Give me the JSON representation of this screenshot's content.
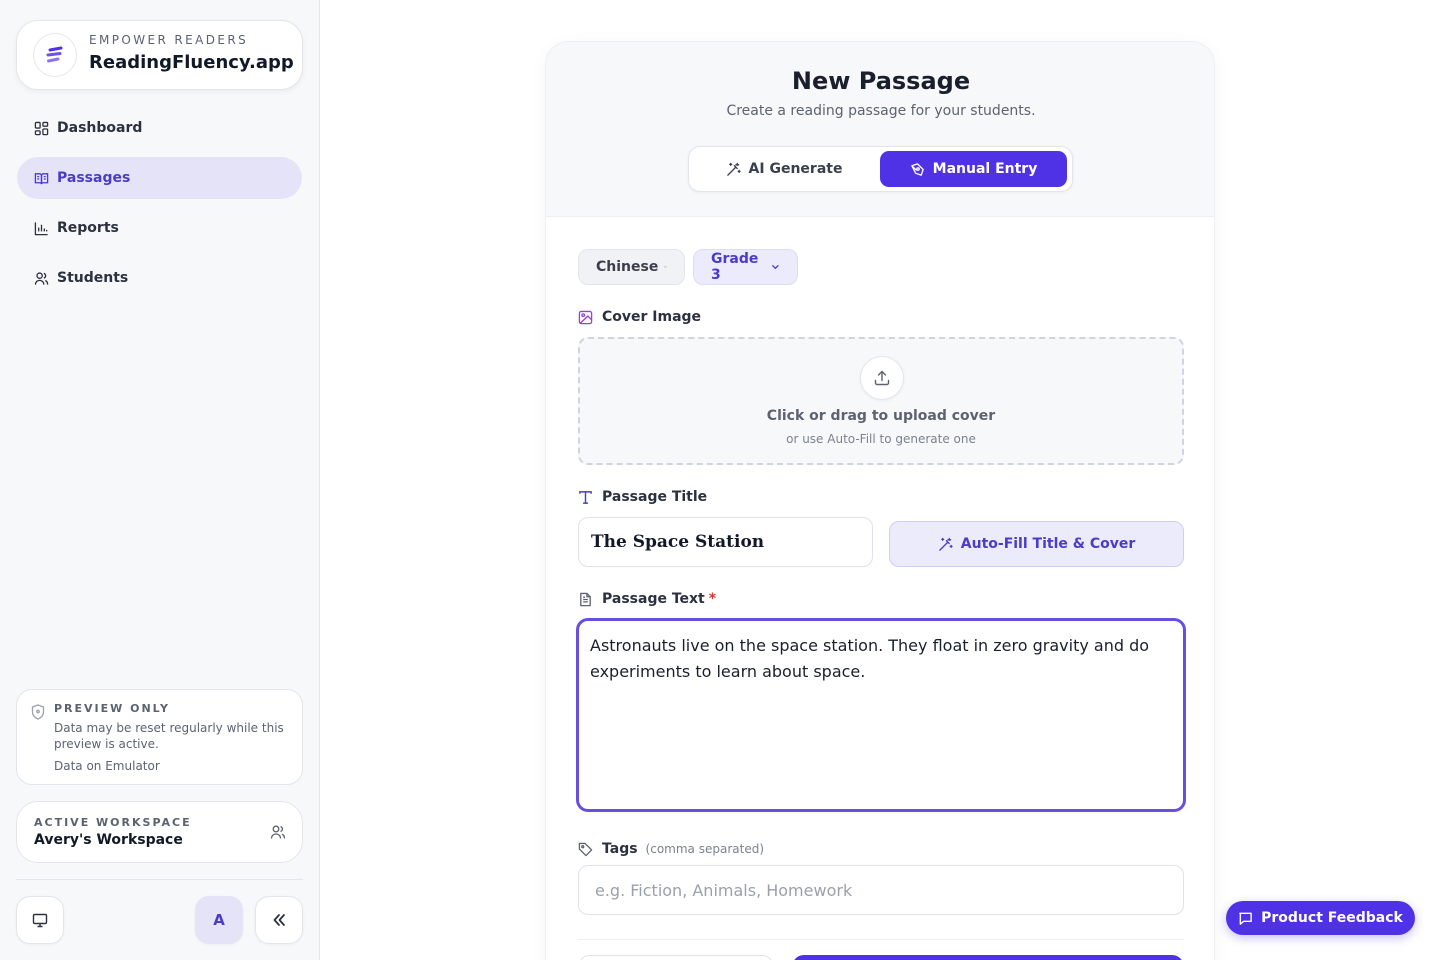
{
  "brand": {
    "tagline": "EMPOWER READERS",
    "name": "ReadingFluency.app",
    "accent": "#4f32e6"
  },
  "nav": [
    {
      "label": "Dashboard",
      "icon": "dashboard-icon",
      "active": false
    },
    {
      "label": "Passages",
      "icon": "book-open-icon",
      "active": true
    },
    {
      "label": "Reports",
      "icon": "bar-chart-icon",
      "active": false
    },
    {
      "label": "Students",
      "icon": "users-icon",
      "active": false
    }
  ],
  "notice": {
    "title": "PREVIEW ONLY",
    "text": "Data may be reset regularly while this preview is active.",
    "footer": "Data on Emulator"
  },
  "workspace": {
    "label": "ACTIVE WORKSPACE",
    "name": "Avery's Workspace"
  },
  "user": {
    "initial": "A"
  },
  "page": {
    "title": "New Passage",
    "subtitle": "Create a reading passage for your students.",
    "modes": [
      {
        "label": "AI Generate",
        "selected": false
      },
      {
        "label": "Manual Entry",
        "selected": true
      }
    ]
  },
  "filters": {
    "language": "Chinese",
    "grade": "Grade 3"
  },
  "cover": {
    "label": "Cover Image",
    "upload_text": "Click or drag to upload cover",
    "upload_hint": "or use Auto-Fill to generate one"
  },
  "passage_title": {
    "label": "Passage Title",
    "value": "The Space Station",
    "autofill_label": "Auto-Fill Title & Cover"
  },
  "passage_text": {
    "label": "Passage Text",
    "required_mark": "*",
    "value": "Astronauts live on the space station. They float in zero gravity and do experiments to learn about space."
  },
  "tags": {
    "label": "Tags",
    "hint": "(comma separated)",
    "placeholder": "e.g. Fiction, Animals, Homework"
  },
  "feedback": {
    "label": "Product Feedback"
  }
}
